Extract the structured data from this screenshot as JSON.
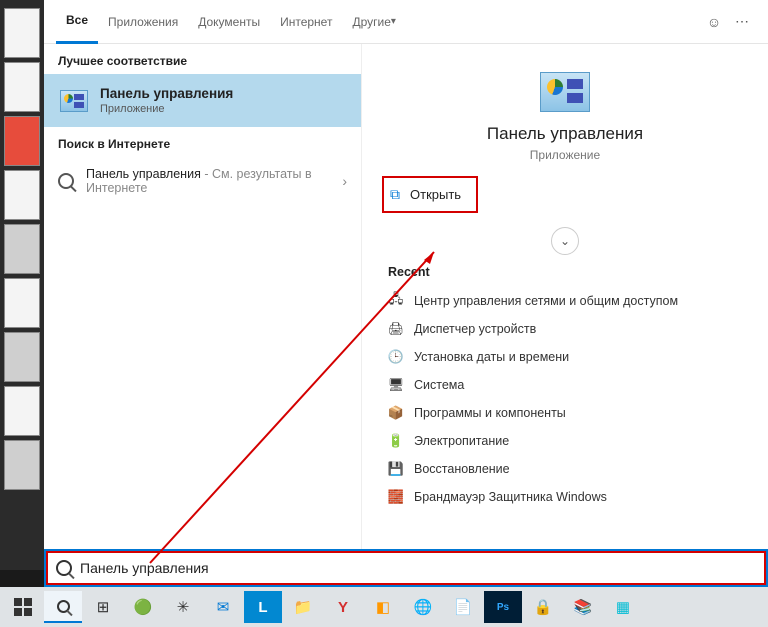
{
  "tabs": {
    "all": "Все",
    "apps": "Приложения",
    "docs": "Документы",
    "web": "Интернет",
    "more": "Другие"
  },
  "left": {
    "best_label": "Лучшее соответствие",
    "best_title": "Панель управления",
    "best_sub": "Приложение",
    "web_label": "Поиск в Интернете",
    "web_query": "Панель управления",
    "web_suffix": " - См. результаты в Интернете"
  },
  "right": {
    "title": "Панель управления",
    "sub": "Приложение",
    "open": "Открыть",
    "recent_label": "Recent",
    "recent": [
      {
        "icon": "🖧",
        "label": "Центр управления сетями и общим доступом"
      },
      {
        "icon": "🖨",
        "label": "Диспетчер устройств"
      },
      {
        "icon": "🕒",
        "label": "Установка даты и времени"
      },
      {
        "icon": "🖥",
        "label": "Система"
      },
      {
        "icon": "📦",
        "label": "Программы и компоненты"
      },
      {
        "icon": "🔋",
        "label": "Электропитание"
      },
      {
        "icon": "💾",
        "label": "Восстановление"
      },
      {
        "icon": "🧱",
        "label": "Брандмауэр Защитника Windows"
      }
    ]
  },
  "search_value": "Панель управления"
}
